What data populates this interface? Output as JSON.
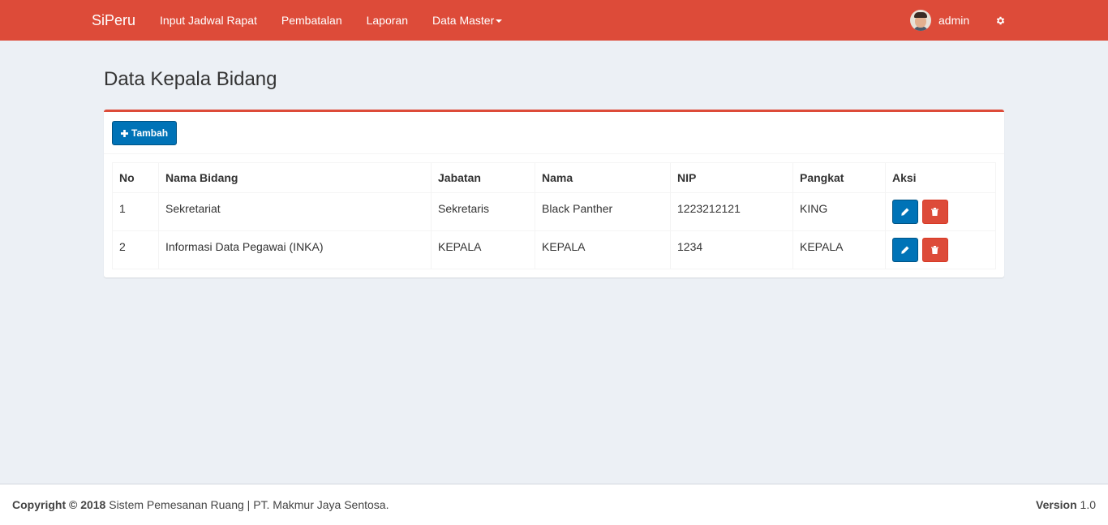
{
  "navbar": {
    "brand": "SiPeru",
    "links": [
      "Input Jadwal Rapat",
      "Pembatalan",
      "Laporan",
      "Data Master"
    ],
    "user": "admin",
    "bg_color": "#dd4b39"
  },
  "page": {
    "title": "Data Kepala Bidang"
  },
  "toolbar": {
    "add_label": "Tambah"
  },
  "table": {
    "headers": [
      "No",
      "Nama Bidang",
      "Jabatan",
      "Nama",
      "NIP",
      "Pangkat",
      "Aksi"
    ],
    "rows": [
      {
        "no": "1",
        "bidang": "Sekretariat",
        "jabatan": "Sekretaris",
        "nama": "Black Panther",
        "nip": "1223212121",
        "pangkat": "KING"
      },
      {
        "no": "2",
        "bidang": "Informasi Data Pegawai (INKA)",
        "jabatan": "KEPALA",
        "nama": "KEPALA",
        "nip": "1234",
        "pangkat": "KEPALA"
      }
    ]
  },
  "footer": {
    "copyright_bold": "Copyright © 2018",
    "copyright_text": "Sistem Pemesanan Ruang | PT. Makmur Jaya Sentosa.",
    "version_label": "Version",
    "version_value": "1.0"
  },
  "icons": {
    "add": "plus-icon",
    "edit": "pencil-icon",
    "delete": "trash-icon",
    "settings": "gear-icon"
  }
}
